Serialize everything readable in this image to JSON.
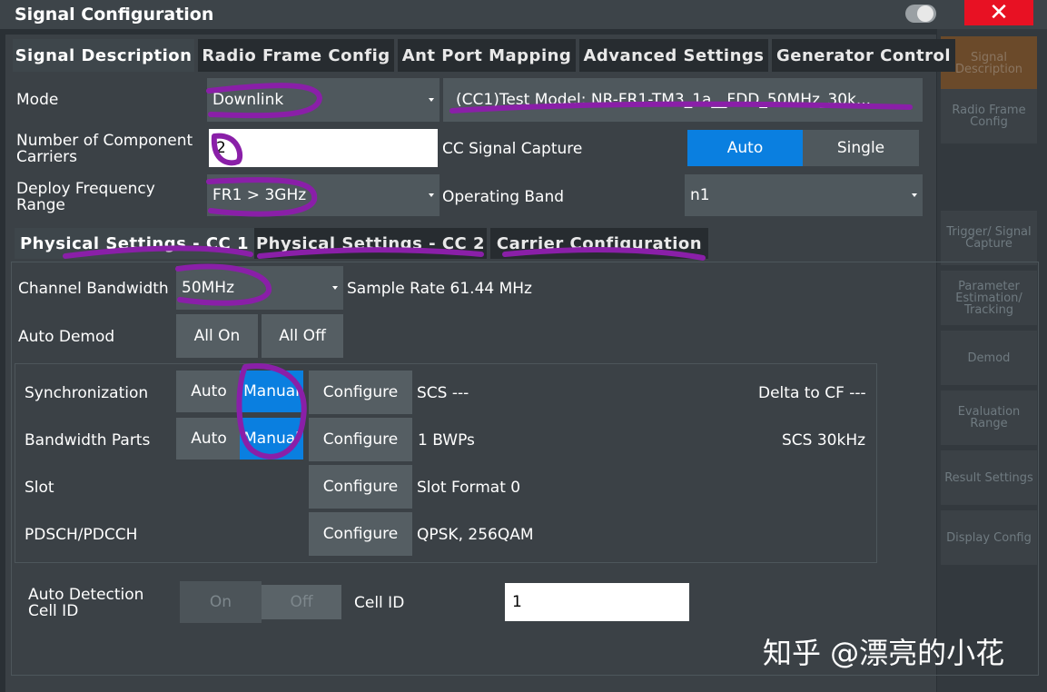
{
  "window": {
    "title": "Signal Configuration"
  },
  "side_menu": [
    "Signal Description",
    "Radio Frame Config",
    "Trigger/ Signal Capture",
    "Parameter Estimation/ Tracking",
    "Demod",
    "Evaluation Range",
    "Result Settings",
    "Display Config"
  ],
  "tabs": [
    "Signal Description",
    "Radio Frame Config",
    "Ant Port Mapping",
    "Advanced Settings",
    "Generator Control"
  ],
  "mode": {
    "label": "Mode",
    "value": "Downlink",
    "test_model": "(CC1)Test Model: NR-FR1-TM3_1a__FDD_50MHz_30k..."
  },
  "carriers": {
    "label": "Number of Component Carriers",
    "value": "2"
  },
  "capture": {
    "label": "CC Signal Capture",
    "auto": "Auto",
    "single": "Single"
  },
  "deploy": {
    "label": "Deploy Frequency Range",
    "value": "FR1 > 3GHz"
  },
  "band": {
    "label": "Operating Band",
    "value": "n1"
  },
  "sub_tabs": [
    "Physical Settings - CC 1",
    "Physical Settings - CC 2",
    "Carrier Configuration"
  ],
  "channel_bw": {
    "label": "Channel Bandwidth",
    "value": "50MHz",
    "sample_rate": "Sample Rate 61.44 MHz"
  },
  "auto_demod": {
    "label": "Auto Demod",
    "on": "All On",
    "off": "All Off"
  },
  "sync": {
    "label": "Synchronization",
    "auto": "Auto",
    "manual": "Manual",
    "configure": "Configure",
    "info": "SCS ---",
    "delta": "Delta to CF ---"
  },
  "bwp": {
    "label": "Bandwidth Parts",
    "auto": "Auto",
    "manual": "Manual",
    "configure": "Configure",
    "info": "1 BWPs",
    "scs": "SCS 30kHz"
  },
  "slot": {
    "label": "Slot",
    "configure": "Configure",
    "info": "Slot Format 0"
  },
  "pdsch": {
    "label": "PDSCH/PDCCH",
    "configure": "Configure",
    "info": "QPSK, 256QAM"
  },
  "cell": {
    "auto_label": "Auto Detection Cell ID",
    "on": "On",
    "off": "Off",
    "id_label": "Cell ID",
    "id_value": "1"
  },
  "watermark": "知乎 @漂亮的小花",
  "colors": {
    "accent": "#0a7fe0",
    "close": "#e81123",
    "annotation": "#8a1fa8"
  }
}
